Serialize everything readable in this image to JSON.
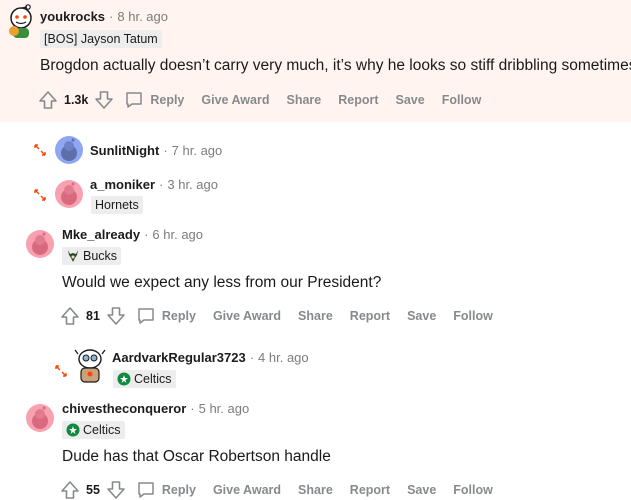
{
  "comments": [
    {
      "author": "youkrocks",
      "time": "8 hr. ago",
      "flair": "[BOS] Jayson Tatum",
      "body": "Brogdon actually doesn’t carry very much, it’s why he looks so stiff dribbling sometimes.",
      "score": "1.3k"
    },
    {
      "author": "SunlitNight",
      "time": "7 hr. ago"
    },
    {
      "author": "a_moniker",
      "time": "3 hr. ago",
      "flair": "Hornets"
    },
    {
      "author": "Mke_already",
      "time": "6 hr. ago",
      "flair": "Bucks",
      "body": "Would we expect any less from our President?",
      "score": "81"
    },
    {
      "author": "AardvarkRegular3723",
      "time": "4 hr. ago",
      "flair": "Celtics"
    },
    {
      "author": "chivestheconqueror",
      "time": "5 hr. ago",
      "flair": "Celtics",
      "body": "Dude has that Oscar Robertson handle",
      "score": "55"
    }
  ],
  "actions": {
    "reply": "Reply",
    "give_award": "Give Award",
    "share": "Share",
    "report": "Report",
    "save": "Save",
    "follow": "Follow"
  },
  "colors": {
    "highlight_bg": "#fff4ef",
    "expand_orange": "#ff4500",
    "avatar_pink": "#f7a1b1",
    "avatar_blue": "#8fa6f2",
    "celtics_green": "#0f8a3c",
    "bucks_green": "#2f4a2a"
  },
  "icons": [
    "reddit-avatar-icon",
    "upvote-icon",
    "downvote-icon",
    "comment-bubble-icon",
    "expand-thread-icon",
    "bucks-logo-icon",
    "celtics-logo-icon"
  ]
}
